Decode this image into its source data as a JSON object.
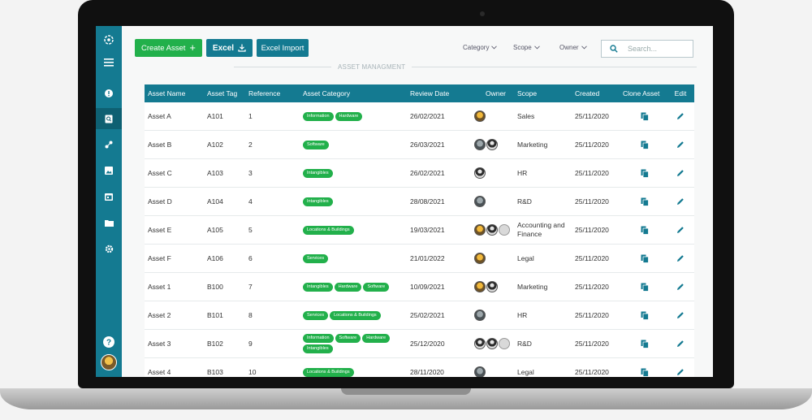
{
  "toolbar": {
    "create_label": "Create Asset",
    "excel_label": "Excel",
    "import_label": "Excel Import"
  },
  "filters": [
    {
      "label": "Category"
    },
    {
      "label": "Scope"
    },
    {
      "label": "Owner"
    }
  ],
  "search": {
    "placeholder": "Search..."
  },
  "section_title": "ASSET MANAGMENT",
  "table": {
    "headers": [
      "Asset Name",
      "Asset Tag",
      "Reference",
      "Asset Category",
      "Review Date",
      "Owner",
      "Scope",
      "Created",
      "Clone Asset",
      "Edit"
    ],
    "rows": [
      {
        "name": "Asset A",
        "tag": "A101",
        "ref": "1",
        "categories": [
          "Information",
          "Hardware"
        ],
        "review": "26/02/2021",
        "owners": [
          "a"
        ],
        "scope": "Sales",
        "created": "25/11/2020"
      },
      {
        "name": "Asset B",
        "tag": "A102",
        "ref": "2",
        "categories": [
          "Software"
        ],
        "review": "26/03/2021",
        "owners": [
          "d",
          "b"
        ],
        "scope": "Marketing",
        "created": "25/11/2020"
      },
      {
        "name": "Asset C",
        "tag": "A103",
        "ref": "3",
        "categories": [
          "Intangibles"
        ],
        "review": "26/02/2021",
        "owners": [
          "b"
        ],
        "scope": "HR",
        "created": "25/11/2020"
      },
      {
        "name": "Asset D",
        "tag": "A104",
        "ref": "4",
        "categories": [
          "Intangibles"
        ],
        "review": "28/08/2021",
        "owners": [
          "d"
        ],
        "scope": "R&D",
        "created": "25/11/2020"
      },
      {
        "name": "Asset E",
        "tag": "A105",
        "ref": "5",
        "categories": [
          "Locations & Buildings"
        ],
        "review": "19/03/2021",
        "owners": [
          "a",
          "b",
          "c"
        ],
        "scope": "Accounting and Finance",
        "created": "25/11/2020"
      },
      {
        "name": "Asset F",
        "tag": "A106",
        "ref": "6",
        "categories": [
          "Services"
        ],
        "review": "21/01/2022",
        "owners": [
          "a"
        ],
        "scope": "Legal",
        "created": "25/11/2020"
      },
      {
        "name": "Asset 1",
        "tag": "B100",
        "ref": "7",
        "categories": [
          "Intangibles",
          "Hardware",
          "Software"
        ],
        "review": "10/09/2021",
        "owners": [
          "a",
          "b"
        ],
        "scope": "Marketing",
        "created": "25/11/2020"
      },
      {
        "name": "Asset 2",
        "tag": "B101",
        "ref": "8",
        "categories": [
          "Services",
          "Locations & Buildings"
        ],
        "review": "25/02/2021",
        "owners": [
          "d"
        ],
        "scope": "HR",
        "created": "25/11/2020"
      },
      {
        "name": "Asset 3",
        "tag": "B102",
        "ref": "9",
        "categories": [
          "Information",
          "Software",
          "Hardware",
          "Intangibles"
        ],
        "review": "25/12/2020",
        "owners": [
          "b",
          "b",
          "c"
        ],
        "scope": "R&D",
        "created": "25/11/2020"
      },
      {
        "name": "Asset 4",
        "tag": "B103",
        "ref": "10",
        "categories": [
          "Locations & Buildings"
        ],
        "review": "28/11/2020",
        "owners": [
          "d"
        ],
        "scope": "Legal",
        "created": "25/11/2020"
      }
    ]
  },
  "sidebar": {
    "items": [
      {
        "icon": "logo-icon"
      },
      {
        "icon": "menu-icon"
      },
      {
        "icon": "alert-icon"
      },
      {
        "icon": "asset-search-icon"
      },
      {
        "icon": "share-icon"
      },
      {
        "icon": "image-icon"
      },
      {
        "icon": "calendar-icon"
      },
      {
        "icon": "folder-icon"
      },
      {
        "icon": "settings-icon"
      },
      {
        "icon": "help-icon"
      }
    ]
  },
  "colors": {
    "brand": "#147a91",
    "accent": "#22b04b"
  }
}
